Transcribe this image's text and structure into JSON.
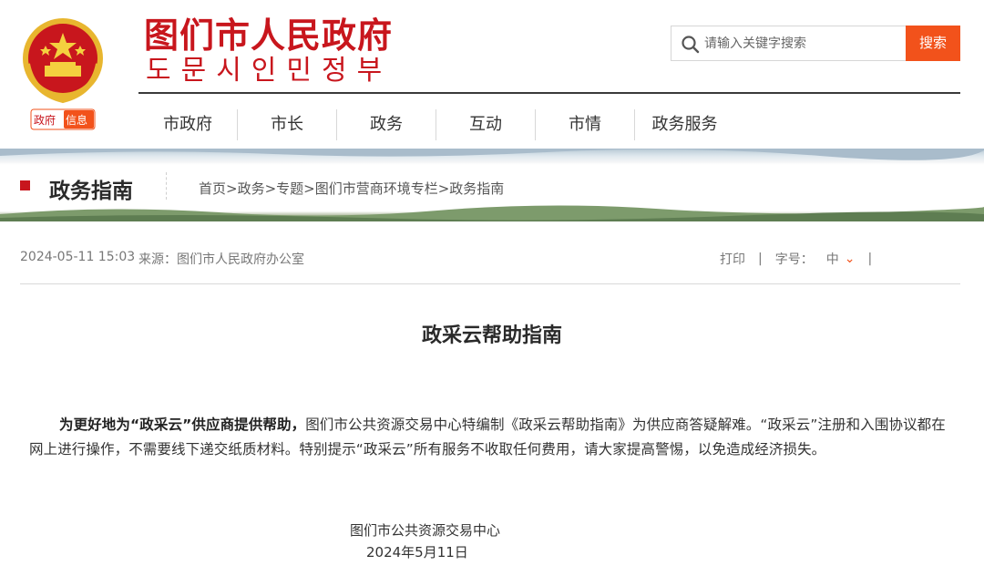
{
  "header": {
    "title_cn": "图们市人民政府",
    "title_kr": "도문시인민정부",
    "badge": {
      "left": "政府",
      "right": "信息"
    },
    "brand_color": "#c8161d",
    "accent_color": "#f2521b",
    "search": {
      "placeholder": "请输入关键字搜索",
      "button": "搜索",
      "icon": "search-icon"
    }
  },
  "nav": {
    "items": [
      "市政府",
      "市长",
      "政务",
      "互动",
      "市情",
      "政务服务"
    ]
  },
  "banner": {
    "section_title": "政务指南",
    "breadcrumb": "首页>政务>专题>图们市营商环境专栏>政务指南"
  },
  "meta": {
    "date": "2024-05-11 15:03",
    "source": "来源：图们市人民政府办公室",
    "print": "打印",
    "sep": "|",
    "font_size_label": "字号：",
    "font_size_value": "中",
    "chevron": "⌄"
  },
  "article": {
    "title": "政采云帮助指南",
    "lead": "为更好地为“政采云”供应商提供帮助，",
    "body": "图们市公共资源交易中心特编制《政采云帮助指南》为供应商答疑解难。“政采云”注册和入围协议都在网上进行操作，不需要线下递交纸质材料。特别提示“政采云”所有服务不收取任何费用，请大家提高警惕，以免造成经济损失。",
    "sign_org": "图们市公共资源交易中心",
    "sign_date": "2024年5月11日"
  }
}
